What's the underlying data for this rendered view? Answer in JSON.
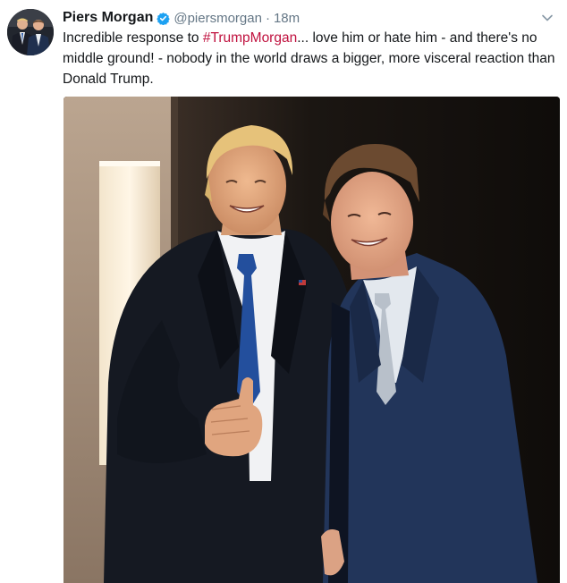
{
  "tweet": {
    "display_name": "Piers Morgan",
    "handle": "@piersmorgan",
    "separator": "·",
    "timestamp": "18m",
    "text_before": "Incredible response to ",
    "hashtag": "#TrumpMorgan",
    "text_after": "... love him or hate him - and there's no middle ground! - nobody in the world draws a bigger, more visceral reaction than Donald Trump.",
    "verified": true
  },
  "icons": {
    "verified": "verified-badge-icon",
    "caret": "chevron-down-icon"
  },
  "colors": {
    "name": "#14171a",
    "secondary": "#657786",
    "hashtag": "#c0123f",
    "verified": "#1da1f2"
  }
}
